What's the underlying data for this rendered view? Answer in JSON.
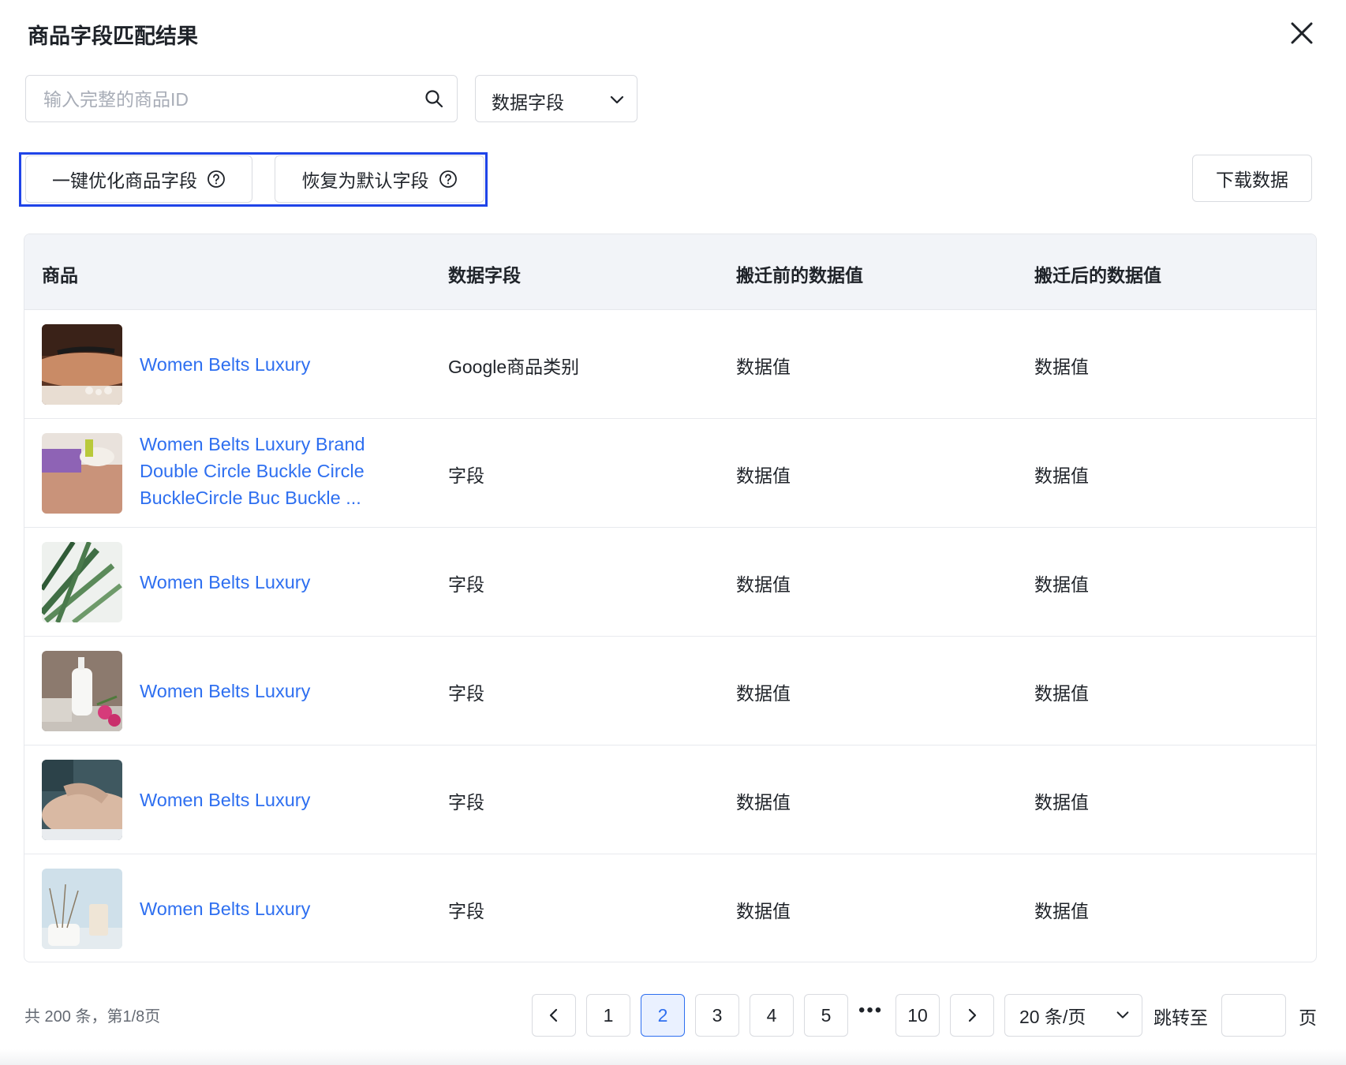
{
  "dialog": {
    "title": "商品字段匹配结果"
  },
  "search": {
    "placeholder": "输入完整的商品ID"
  },
  "field_select": {
    "value": "数据字段"
  },
  "actions": {
    "optimize_label": "一键优化商品字段",
    "reset_label": "恢复为默认字段",
    "download_label": "下载数据"
  },
  "table": {
    "headers": [
      "商品",
      "数据字段",
      "搬迁前的数据值",
      "搬迁后的数据值"
    ],
    "rows": [
      {
        "name": "Women Belts Luxury",
        "field": "Google商品类别",
        "before": "数据值",
        "after": "数据值"
      },
      {
        "name_lines": [
          "Women Belts Luxury Brand",
          "Double Circle Buckle Circle",
          "BuckleCircle Buc Buckle ..."
        ],
        "field": "字段",
        "before": "数据值",
        "after": "数据值"
      },
      {
        "name": "Women Belts Luxury",
        "field": "字段",
        "before": "数据值",
        "after": "数据值"
      },
      {
        "name": "Women Belts Luxury",
        "field": "字段",
        "before": "数据值",
        "after": "数据值"
      },
      {
        "name": "Women Belts Luxury",
        "field": "字段",
        "before": "数据值",
        "after": "数据值"
      },
      {
        "name": "Women Belts Luxury",
        "field": "字段",
        "before": "数据值",
        "after": "数据值"
      }
    ]
  },
  "pagination": {
    "summary": "共 200 条，第1/8页",
    "pages": [
      "1",
      "2",
      "3",
      "4",
      "5"
    ],
    "current": "2",
    "ellipsis": "•••",
    "last": "10",
    "page_size": "20 条/页",
    "jump_label": "跳转至",
    "page_unit": "页"
  },
  "colors": {
    "link": "#2e6ff0",
    "highlight_border": "#1f44e8",
    "header_bg": "#f2f4f8"
  }
}
